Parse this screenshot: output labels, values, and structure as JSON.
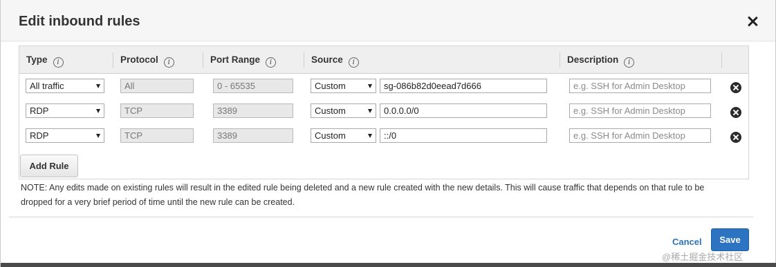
{
  "dialog": {
    "title": "Edit inbound rules"
  },
  "table": {
    "headers": {
      "type": "Type",
      "protocol": "Protocol",
      "port_range": "Port Range",
      "source": "Source",
      "description": "Description"
    },
    "info_glyph": "i",
    "rows": [
      {
        "type": "All traffic",
        "protocol": "All",
        "port_range": "0 - 65535",
        "source_type": "Custom",
        "source_value": "sg-086b82d0eead7d666",
        "description_placeholder": "e.g. SSH for Admin Desktop"
      },
      {
        "type": "RDP",
        "protocol": "TCP",
        "port_range": "3389",
        "source_type": "Custom",
        "source_value": "0.0.0.0/0",
        "description_placeholder": "e.g. SSH for Admin Desktop"
      },
      {
        "type": "RDP",
        "protocol": "TCP",
        "port_range": "3389",
        "source_type": "Custom",
        "source_value": "::/0",
        "description_placeholder": "e.g. SSH for Admin Desktop"
      }
    ]
  },
  "actions": {
    "add_rule": "Add Rule",
    "cancel": "Cancel",
    "save": "Save"
  },
  "note": "NOTE: Any edits made on existing rules will result in the edited rule being deleted and a new rule created with the new details. This will cause traffic that depends on that rule to be dropped for a very brief period of time until the new rule can be created.",
  "watermark": "@稀土掘金技术社区",
  "icons": {
    "close": "close-icon",
    "info": "info-icon",
    "delete": "delete-circle-icon",
    "dropdown": "caret-down-icon"
  },
  "colors": {
    "primary_button": "#2c74c1",
    "link": "#2e73b8",
    "header_bg": "#f6f6f6"
  }
}
